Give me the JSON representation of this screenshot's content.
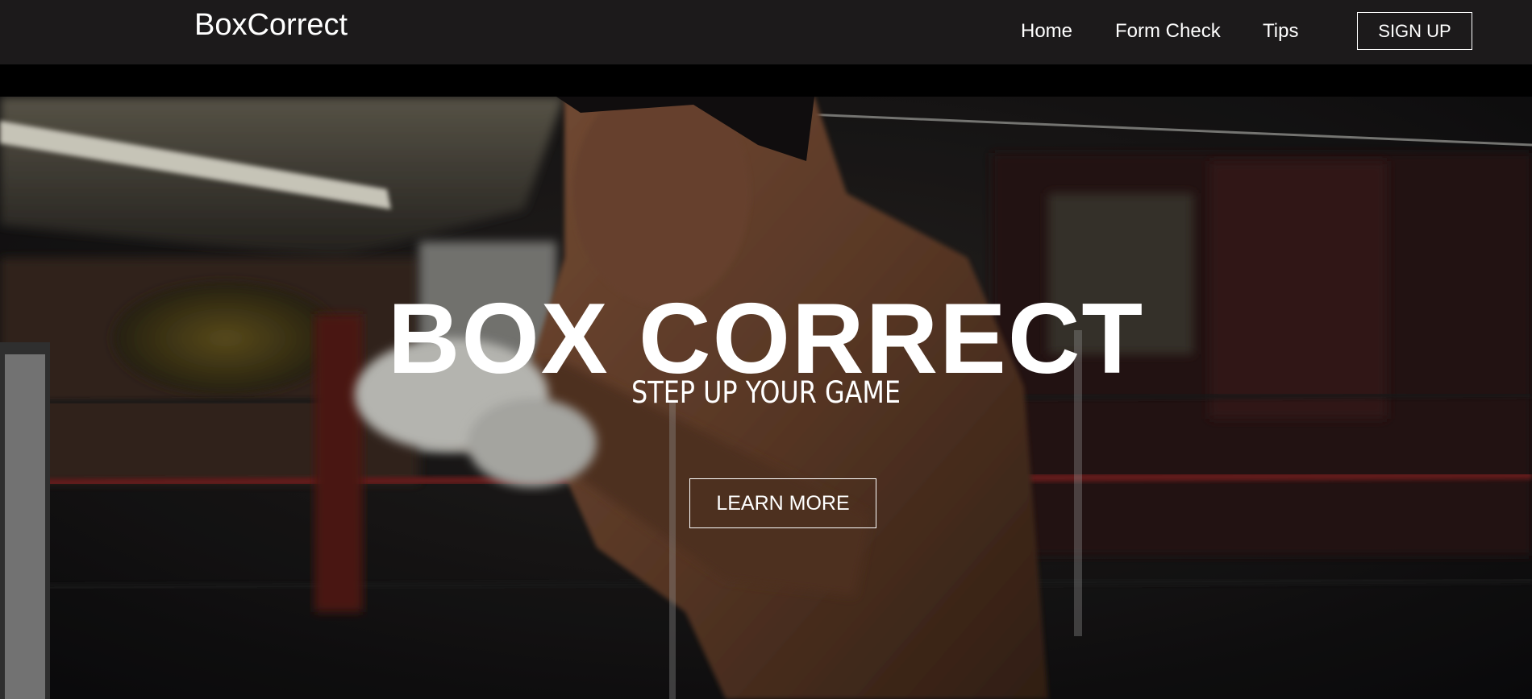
{
  "nav": {
    "brand": "BoxCorrect",
    "links": [
      {
        "label": "Home"
      },
      {
        "label": "Form Check"
      },
      {
        "label": "Tips"
      }
    ],
    "signup_label": "SIGN UP"
  },
  "hero": {
    "title": "BOX CORRECT",
    "subtitle": "STEP UP YOUR GAME",
    "cta_label": "LEARN MORE",
    "background": "boxer-training-photo"
  },
  "colors": {
    "navbar_bg": "#1c1a1b",
    "text": "#ffffff",
    "band": "#000000"
  }
}
